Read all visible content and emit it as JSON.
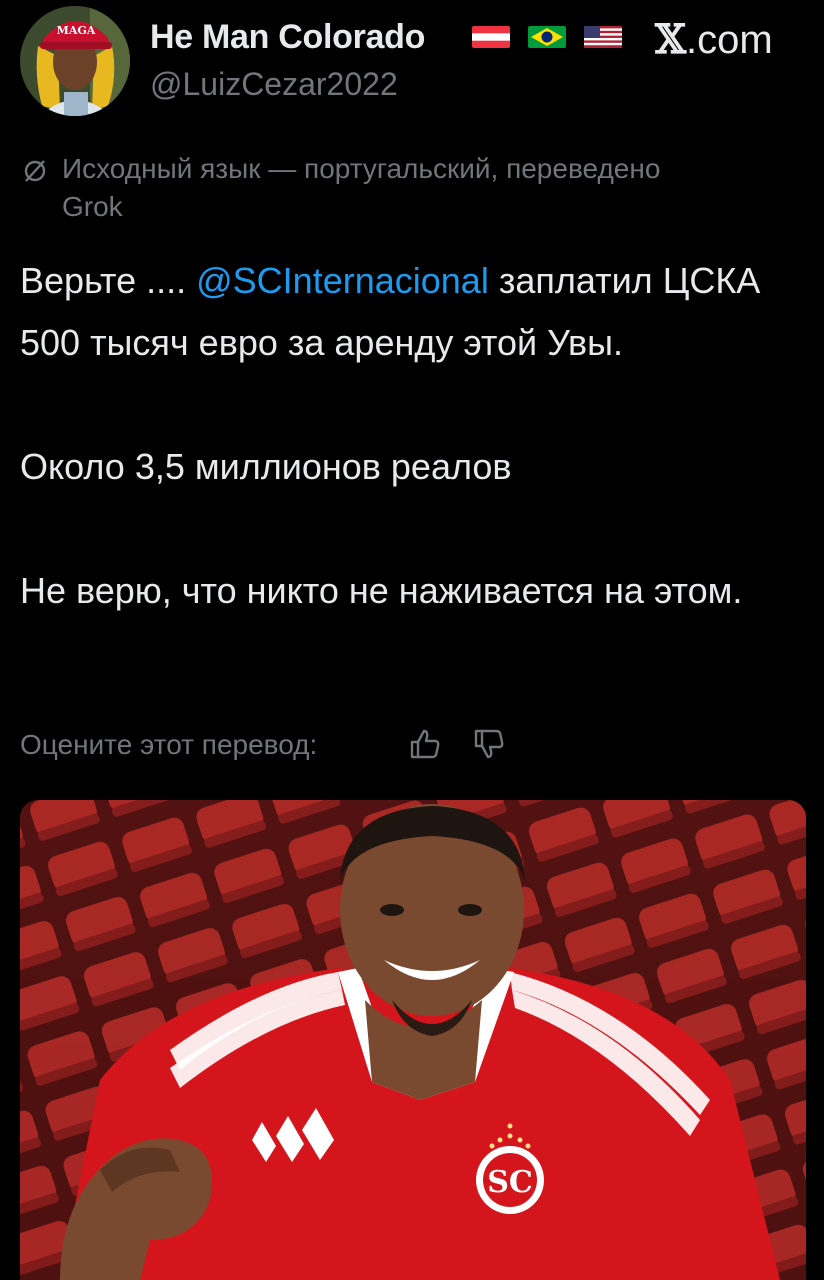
{
  "post": {
    "author": {
      "display_name": "He Man Colorado",
      "handle": "@LuizCezar2022",
      "avatar_cap_text": "MAGA",
      "flags": [
        "flag-austria-icon",
        "flag-brazil-icon",
        "flag-usa-icon"
      ]
    },
    "site_label_mark": "𝕏",
    "site_label_suffix": ".com",
    "translation_note": "Исходный язык — португальский, переведено Grok",
    "text": {
      "line1_prefix": "Верьте .... ",
      "mention": "@SCInternacional",
      "line1_suffix": " заплатил ЦСКА 500 тысяч евро за аренду этой Увы.",
      "paragraph2": "Около 3,5 миллионов реалов",
      "paragraph3": "Не верю, что никто не наживается на этом."
    },
    "rate_translation_label": "Оцените этот перевод:",
    "media": {
      "type": "photo",
      "description_icon": "photo-person-in-stadium-icon"
    }
  },
  "colors": {
    "background": "#000000",
    "text_primary": "#e7e9ea",
    "text_secondary": "#71767b",
    "link": "#1d9bf0",
    "jersey_red": "#d4151c",
    "seat_red": "#c9302c"
  }
}
